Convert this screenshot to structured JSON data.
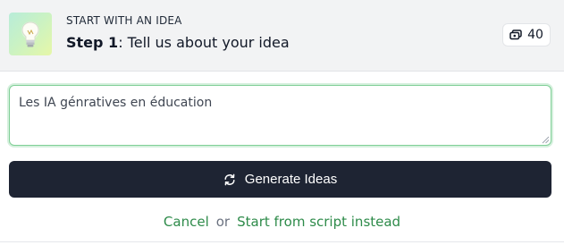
{
  "header": {
    "kicker": "START WITH AN IDEA",
    "step_prefix": "Step 1",
    "step_text": ": Tell us about your idea",
    "thumbnail_icon": "lightbulb-icon",
    "credits": {
      "icon": "coins-icon",
      "count": "40"
    }
  },
  "idea_input": {
    "value": "Les IA génratives en éducation",
    "accent_color": "#7fcf96"
  },
  "generate_button": {
    "label": "Generate Ideas",
    "icon": "refresh-icon",
    "background": "#1e2433"
  },
  "footer": {
    "cancel_label": "Cancel",
    "or_label": "or",
    "script_label": "Start from script instead",
    "link_color": "#2e8b4a"
  }
}
